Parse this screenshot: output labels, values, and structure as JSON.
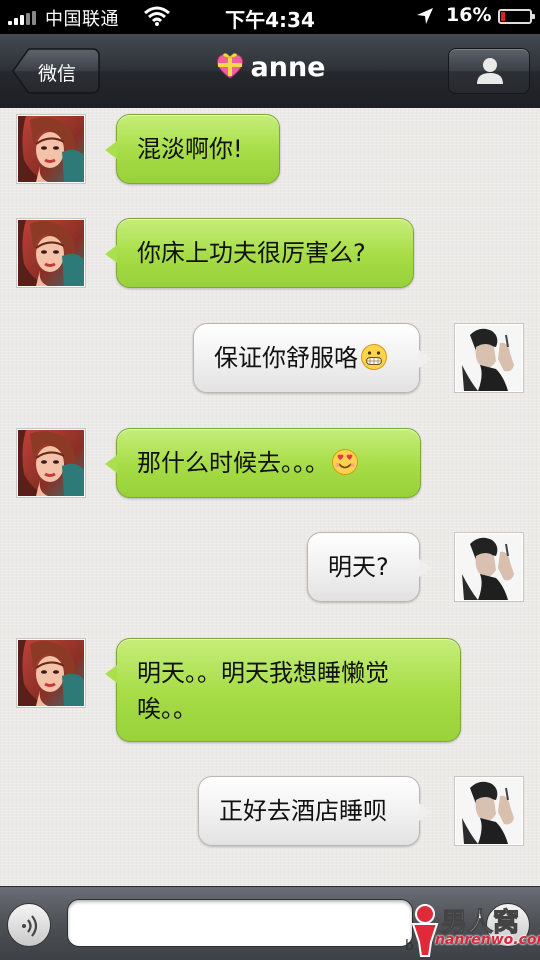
{
  "status_bar": {
    "carrier": "中国联通",
    "time": "下午4:34",
    "battery": "16%",
    "battery_level": 0.16
  },
  "nav": {
    "back_label": "微信",
    "title": "anne",
    "title_icon": "heart-gift-icon",
    "right_icon": "profile-icon"
  },
  "messages": [
    {
      "side": "left",
      "sender": "anne",
      "text": "混淡啊你!",
      "emoji": null
    },
    {
      "side": "left",
      "sender": "anne",
      "text": "你床上功夫很厉害么?",
      "emoji": null
    },
    {
      "side": "right",
      "sender": "me",
      "text": "保证你舒服咯",
      "emoji": "grin-emoji"
    },
    {
      "side": "left",
      "sender": "anne",
      "text": "那什么时候去。。。",
      "emoji": "heart-eyes-emoji"
    },
    {
      "side": "right",
      "sender": "me",
      "text": "明天?",
      "emoji": null
    },
    {
      "side": "left",
      "sender": "anne",
      "text_line1": "明天。。明天我想睡懒觉",
      "text_line2": "唉。。",
      "emoji": null
    },
    {
      "side": "right",
      "sender": "me",
      "text": "正好去酒店睡呗",
      "emoji": null
    }
  ],
  "input": {
    "value": "",
    "placeholder": ""
  },
  "watermark": {
    "site_cn": "男人窝",
    "url": "nanrenwo.com",
    "prefix": "b"
  },
  "colors": {
    "left_bubble": "#a6dc45",
    "right_bubble": "#f0f0f0",
    "nav_bar": "#2e3238",
    "battery_low": "#e02020"
  }
}
